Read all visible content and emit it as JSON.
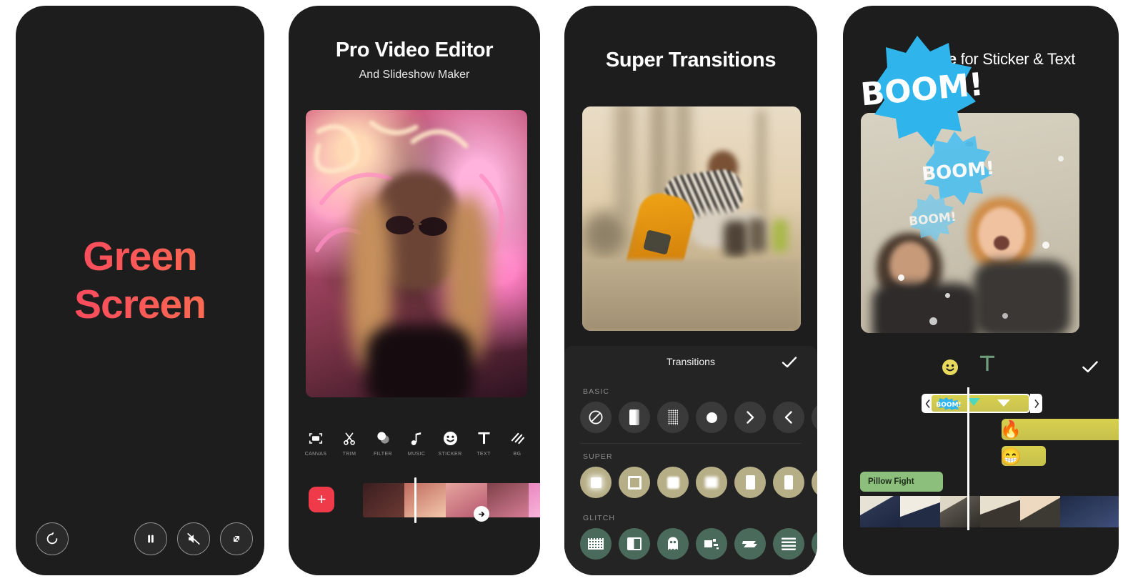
{
  "page": {
    "background": "#ffffff",
    "panel_background": "#1d1d1d",
    "accent_red": "#ef3b49",
    "accent_green": "#8cbe7c",
    "accent_yellow": "#d7d04e",
    "gradient_start": "#f93f63",
    "gradient_end": "#fb7d4c"
  },
  "panel1": {
    "name": "green-screen-preview",
    "headline_line1": "Green",
    "headline_line2": "Screen",
    "controls": [
      {
        "name": "replay-button",
        "icon": "replay-icon",
        "label": "Replay"
      },
      {
        "name": "pause-button",
        "icon": "pause-icon",
        "label": "Pause"
      },
      {
        "name": "mute-button",
        "icon": "mute-icon",
        "label": "Mute"
      },
      {
        "name": "expand-button",
        "icon": "expand-icon",
        "label": "Full screen"
      }
    ]
  },
  "panel2": {
    "title": "Pro Video Editor",
    "subtitle": "And Slideshow Maker",
    "preview_alt": "Woman with sunglasses in front of neon lights",
    "toolbar": [
      {
        "icon": "canvas-icon",
        "label": "CANVAS"
      },
      {
        "icon": "scissors-icon",
        "label": "TRIM"
      },
      {
        "icon": "filter-icon",
        "label": "FILTER"
      },
      {
        "icon": "music-note-icon",
        "label": "MUSIC"
      },
      {
        "icon": "smiley-icon",
        "label": "STICKER"
      },
      {
        "icon": "text-t-icon",
        "label": "TEXT"
      },
      {
        "icon": "background-hatch-icon",
        "label": "BG"
      }
    ],
    "add_button_label": "+",
    "next_button_icon": "arrow-right-icon"
  },
  "panel3": {
    "title": "Super Transitions",
    "sheet_title": "Transitions",
    "confirm_icon": "checkmark-icon",
    "groups": [
      {
        "label": "BASIC",
        "items": [
          {
            "icon": "none-slash-icon"
          },
          {
            "icon": "half-fade-icon"
          },
          {
            "icon": "dither-icon"
          },
          {
            "icon": "circle-icon"
          },
          {
            "icon": "chevron-right-icon"
          },
          {
            "icon": "chevron-left-icon"
          },
          {
            "icon": "chevron-down-icon"
          }
        ]
      },
      {
        "label": "SUPER",
        "items": [
          {
            "icon": "square-glow-icon"
          },
          {
            "icon": "square-outline-icon"
          },
          {
            "icon": "square-soft-icon"
          },
          {
            "icon": "square-blur-icon"
          },
          {
            "icon": "square-tall-icon"
          },
          {
            "icon": "square-wipe-icon"
          },
          {
            "icon": "square-edge-icon"
          }
        ]
      },
      {
        "label": "GLITCH",
        "items": [
          {
            "icon": "glitch-noise-icon"
          },
          {
            "icon": "glitch-split-icon"
          },
          {
            "icon": "ghost-icon"
          },
          {
            "icon": "glitch-shatter-icon"
          },
          {
            "icon": "glitch-smear-icon"
          },
          {
            "icon": "glitch-scanline-icon"
          },
          {
            "icon": "glitch-block-icon"
          }
        ]
      }
    ]
  },
  "panel4": {
    "title_bold": "Keyframe",
    "title_rest": " for Sticker & Text",
    "preview_alt": "Two children in a pillow fight",
    "stickers": [
      {
        "text": "BOOM!",
        "size": "large"
      },
      {
        "text": "BOOM!",
        "size": "medium"
      },
      {
        "text": "BOOM!",
        "size": "small"
      }
    ],
    "toolbar": [
      {
        "icon": "sticker-smiley-icon",
        "label": "Sticker"
      },
      {
        "icon": "text-t-icon",
        "label": "Text"
      },
      {
        "icon": "checkmark-icon",
        "label": "Done"
      }
    ],
    "timeline": {
      "selected_clip_label": "BOOM!",
      "handle_left_icon": "chevron-left-icon",
      "handle_right_icon": "chevron-right-icon",
      "keyframe_icon": "keyframe-diamond-icon",
      "marker_icon": "triangle-down-icon",
      "tracks": [
        {
          "name": "sticker-track-boom",
          "emoji": ""
        },
        {
          "name": "sticker-track-fire",
          "emoji": "🔥"
        },
        {
          "name": "sticker-track-grin",
          "emoji": "😁"
        }
      ],
      "clip_name": "Pillow Fight"
    }
  }
}
